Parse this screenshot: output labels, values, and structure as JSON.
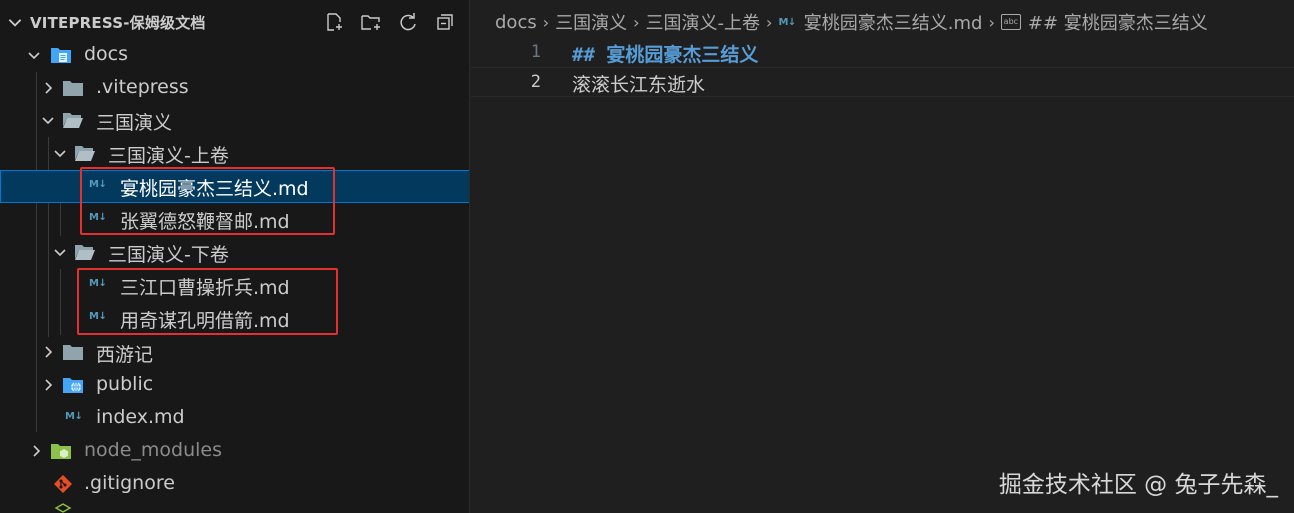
{
  "explorer": {
    "title": "VITEPRESS-保姆级文档",
    "actions": [
      {
        "name": "new-file-icon"
      },
      {
        "name": "new-folder-icon"
      },
      {
        "name": "refresh-icon"
      },
      {
        "name": "collapse-all-icon"
      }
    ],
    "tree": {
      "docs": "docs",
      "vitepress": ".vitepress",
      "sanguo": "三国演义",
      "sanguo_shang": "三国演义-上卷",
      "file_1": "宴桃园豪杰三结义.md",
      "file_2": "张翼德怒鞭督邮.md",
      "sanguo_xia": "三国演义-下卷",
      "file_3": "三江口曹操折兵.md",
      "file_4": "用奇谋孔明借箭.md",
      "xiyouji": "西游记",
      "public": "public",
      "index": "index.md",
      "node_modules": "node_modules",
      "gitignore": ".gitignore"
    },
    "md_icon": "M↓"
  },
  "editor": {
    "breadcrumbs": {
      "c1": "docs",
      "c2": "三国演义",
      "c3": "三国演义-上卷",
      "c4": "宴桃园豪杰三结义.md",
      "c5": "## 宴桃园豪杰三结义",
      "abc": "abc"
    },
    "lines": [
      {
        "number": "1",
        "text": "## 宴桃园豪杰三结义"
      },
      {
        "number": "2",
        "text": "滚滚长江东逝水"
      }
    ]
  },
  "watermark": "掘金技术社区 @ 兔子先森_",
  "colors": {
    "selection_bg": "#04395e",
    "selection_border": "#0078d4",
    "highlight_box": "#e5302d",
    "md_icon": "#519aba",
    "heading": "#569cd6",
    "folder": "#90a4ae",
    "node_modules_folder": "#8bc34a",
    "git": "#e44d26"
  }
}
